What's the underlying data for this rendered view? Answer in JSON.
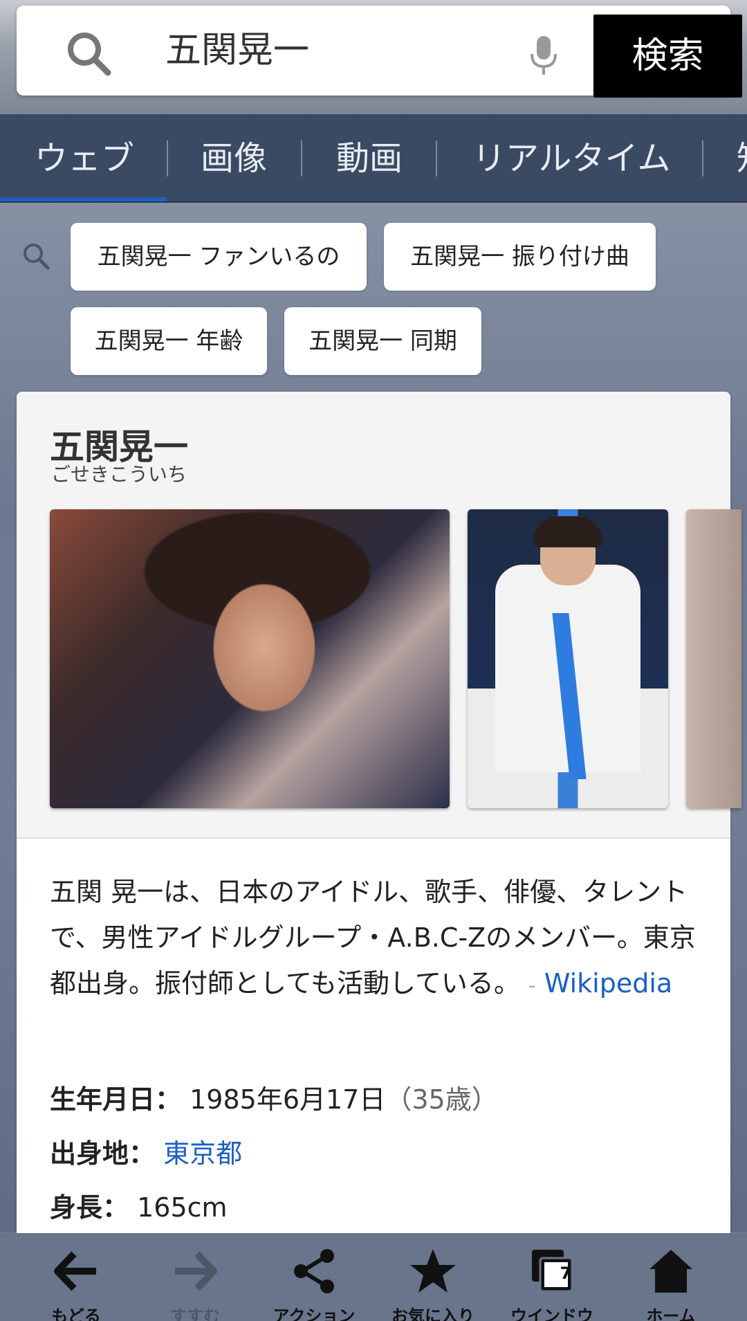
{
  "search": {
    "query": "五関晃一",
    "button_label": "検索"
  },
  "tabs": [
    {
      "label": "ウェブ",
      "active": true
    },
    {
      "label": "画像"
    },
    {
      "label": "動画"
    },
    {
      "label": "リアルタイム"
    },
    {
      "label": "知"
    }
  ],
  "suggestions": [
    "五関晃一 ファンいるの",
    "五関晃一 振り付け曲",
    "五関晃一 年齢",
    "五関晃一 同期"
  ],
  "card": {
    "title": "五関晃一",
    "reading": "ごせきこういち",
    "description": "五関 晃一は、日本のアイドル、歌手、俳優、タレントで、男性アイドルグループ・A.B.C-Zのメンバー。東京都出身。振付師としても活動している。",
    "source_dash": "-",
    "source_link": "Wikipedia",
    "facts": {
      "birth_label": "生年月日：",
      "birth_value": "1985年6月17日",
      "birth_age": "（35歳）",
      "origin_label": "出身地：",
      "origin_value": "東京都",
      "height_label": "身長：",
      "height_value": "165cm"
    }
  },
  "toolbar": {
    "back": "もどる",
    "forward": "すすむ",
    "action": "アクション",
    "favorites": "お気に入り",
    "window": "ウインドウ",
    "window_count": "7",
    "home": "ホーム"
  },
  "colors": {
    "tab_bar": "#3a4a63",
    "link": "#1a5fc4",
    "search_button": "#000000",
    "toolbar": "#68758b"
  }
}
